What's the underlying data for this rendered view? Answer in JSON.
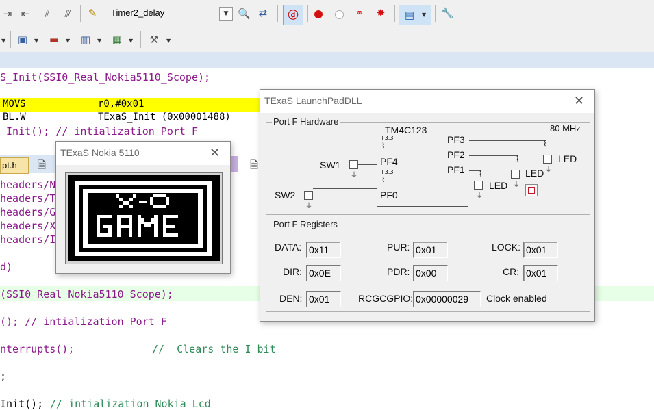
{
  "toolbar": {
    "target_name": "Timer2_delay",
    "icons_row1": [
      "indent-icon",
      "outdent-icon",
      "comment-icon",
      "uncomment-icon",
      "open-file-icon"
    ],
    "icons_row1_right": [
      "find-icon",
      "replace-icon",
      "debug-icon",
      "breakpoint-icon",
      "disable-breakpoint-icon",
      "kill-breakpoints-icon",
      "clear-breakpoints-icon",
      "window-icon",
      "settings-icon"
    ]
  },
  "editor": {
    "top_line": "S_Init(SSI0_Real_Nokia5110_Scope);",
    "asm_rows": [
      {
        "mnemonic": "MOVS",
        "operands": "r0,#0x01"
      },
      {
        "mnemonic": "BL.W",
        "operands": "TExaS_Init (0x00001488)"
      }
    ],
    "partial_line": "_Init(); // intialization Port F",
    "tab_label": "pt.h",
    "headers": [
      "headers/N",
      "headers/T",
      "headers/G",
      "headers/X",
      "headers/I"
    ],
    "paren_line": "d)",
    "scope_line": "(SSI0_Real_Nokia5110_Scope);",
    "portf_line": "(); // intialization Port F",
    "interrupts_code": "nterrupts();",
    "interrupts_comment": "//  Clears the I bit",
    "semi_line": ";",
    "nokia_code": "Init();",
    "nokia_comment": "// intialization Nokia Lcd"
  },
  "nokia_window": {
    "title": "TExaS Nokia 5110",
    "close": "✕"
  },
  "launchpad_window": {
    "title": "TExaS LaunchPadDLL",
    "close": "✕",
    "hardware": {
      "group_label": "Port F Hardware",
      "chip": "TM4C123",
      "clock": "80 MHz",
      "pins": {
        "pf3": "PF3",
        "pf2": "PF2",
        "pf1": "PF1",
        "pf4": "PF4",
        "pf0": "PF0"
      },
      "sw1": "SW1",
      "sw2": "SW2",
      "led": "LED",
      "vcc": "+3.3"
    },
    "registers": {
      "group_label": "Port F Registers",
      "data_label": "DATA:",
      "data_value": "0x11",
      "pur_label": "PUR:",
      "pur_value": "0x01",
      "lock_label": "LOCK:",
      "lock_value": "0x01",
      "dir_label": "DIR:",
      "dir_value": "0x0E",
      "pdr_label": "PDR:",
      "pdr_value": "0x00",
      "cr_label": "CR:",
      "cr_value": "0x01",
      "den_label": "DEN:",
      "den_value": "0x01",
      "rcgc_label": "RCGCGPIO:",
      "rcgc_value": "0x00000029",
      "clock_status": "Clock enabled"
    }
  },
  "colors": {
    "highlight_yellow": "#ffff00",
    "highlight_green": "#e6ffe6",
    "code_purple": "#8b1a8b",
    "code_green": "#2e8b57"
  }
}
